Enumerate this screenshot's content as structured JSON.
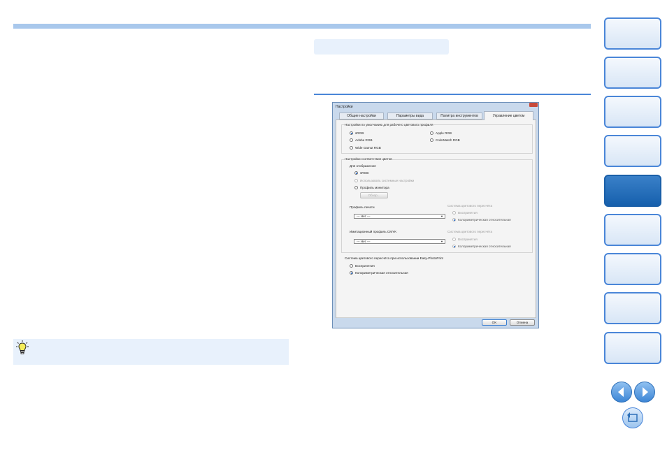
{
  "dialog": {
    "title": "Настройки",
    "tabs": [
      "Общие настройки",
      "Параметры вида",
      "Палитра инструментов",
      "Управление цветом"
    ],
    "default_profile": {
      "heading": "Настройки по умолчанию для рабочего цветового профиля",
      "options": [
        "sRGB",
        "Adobe RGB",
        "Wide Gamut RGB",
        "Apple RGB",
        "ColorMatch RGB"
      ]
    },
    "matching": {
      "heading": "Настройки соответствия цветов",
      "display_label": "Для отображения",
      "display_options": [
        "sRGB",
        "Использовать системные настройки",
        "Профиль монитора"
      ],
      "browse_label": "Обзор...",
      "printer_label": "Профиль печати",
      "printer_value": "--- Нет ---",
      "intent_label": "Система цветового пересчёта",
      "intent_options": [
        "Воспринятия",
        "Колориметрическая относительная"
      ],
      "cmyk_label": "Имитационный профиль CMYK",
      "cmyk_value": "--- Нет ---",
      "cmyk_intent_label": "Система цветового пересчёта",
      "cmyk_intent_options": [
        "Воспринятия",
        "Колориметрическая относительная"
      ]
    },
    "easyphotoprint": {
      "heading": "Система цветового пересчёта при использовании Easy-PhotoPrint",
      "options": [
        "Воспринятия",
        "Колориметрическая относительная"
      ]
    },
    "ok_label": "OK",
    "cancel_label": "Отмена"
  },
  "colors": {
    "accent": "#4a86d8",
    "active_tab": "#1660ad",
    "tint": "#e8f1fc"
  },
  "icons": {
    "tip": "lightbulb-icon",
    "prev": "arrow-left-icon",
    "next": "arrow-right-icon",
    "home": "return-icon"
  }
}
